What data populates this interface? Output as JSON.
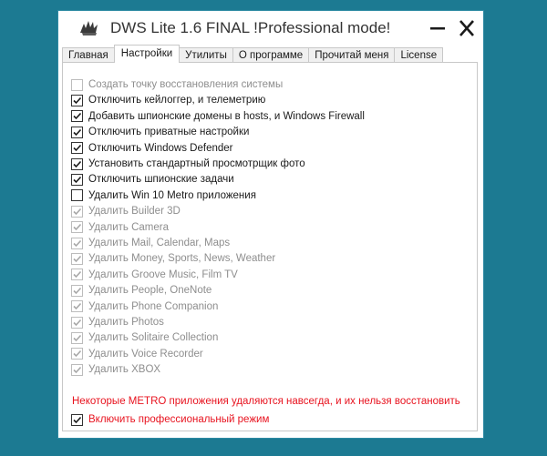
{
  "window": {
    "title": "DWS Lite 1.6 FINAL  !Professional mode!"
  },
  "tabs": [
    {
      "label": "Главная",
      "active": false
    },
    {
      "label": "Настройки",
      "active": true
    },
    {
      "label": "Утилиты",
      "active": false
    },
    {
      "label": "О программе",
      "active": false
    },
    {
      "label": "Прочитай меня",
      "active": false
    },
    {
      "label": "License",
      "active": false
    }
  ],
  "settings": {
    "options": [
      {
        "label": "Создать точку восстановления системы",
        "checked": false,
        "enabled": false
      },
      {
        "label": "Отключить кейлоггер, и телеметрию",
        "checked": true,
        "enabled": true
      },
      {
        "label": "Добавить шпионские домены в hosts, и Windows Firewall",
        "checked": true,
        "enabled": true
      },
      {
        "label": "Отключить приватные настройки",
        "checked": true,
        "enabled": true
      },
      {
        "label": "Отключить Windows Defender",
        "checked": true,
        "enabled": true
      },
      {
        "label": "Установить стандартный просмотрщик фото",
        "checked": true,
        "enabled": true
      },
      {
        "label": "Отключить шпионские задачи",
        "checked": true,
        "enabled": true
      },
      {
        "label": "Удалить Win 10 Metro приложения",
        "checked": false,
        "enabled": true
      },
      {
        "label": "Удалить Builder 3D",
        "checked": true,
        "enabled": false
      },
      {
        "label": "Удалить Camera",
        "checked": true,
        "enabled": false
      },
      {
        "label": "Удалить Mail, Calendar, Maps",
        "checked": true,
        "enabled": false
      },
      {
        "label": "Удалить Money, Sports, News, Weather",
        "checked": true,
        "enabled": false
      },
      {
        "label": "Удалить Groove Music, Film TV",
        "checked": true,
        "enabled": false
      },
      {
        "label": "Удалить People, OneNote",
        "checked": true,
        "enabled": false
      },
      {
        "label": "Удалить Phone Companion",
        "checked": true,
        "enabled": false
      },
      {
        "label": "Удалить Photos",
        "checked": true,
        "enabled": false
      },
      {
        "label": "Удалить Solitaire Collection",
        "checked": true,
        "enabled": false
      },
      {
        "label": "Удалить Voice Recorder",
        "checked": true,
        "enabled": false
      },
      {
        "label": "Удалить XBOX",
        "checked": true,
        "enabled": false
      }
    ],
    "warning": "Некоторые METRO приложения удаляются навсегда, и их нельзя восстановить",
    "pro_mode": {
      "label": "Включить профессиональный режим",
      "checked": true
    }
  },
  "icons": {
    "app": "app-logo-icon",
    "minimize": "minimize-icon",
    "close": "close-icon",
    "check": "check-icon"
  },
  "colors": {
    "desktop": "#1c7a92",
    "warning": "#e8131f",
    "disabled_text": "#8e8e8e"
  }
}
